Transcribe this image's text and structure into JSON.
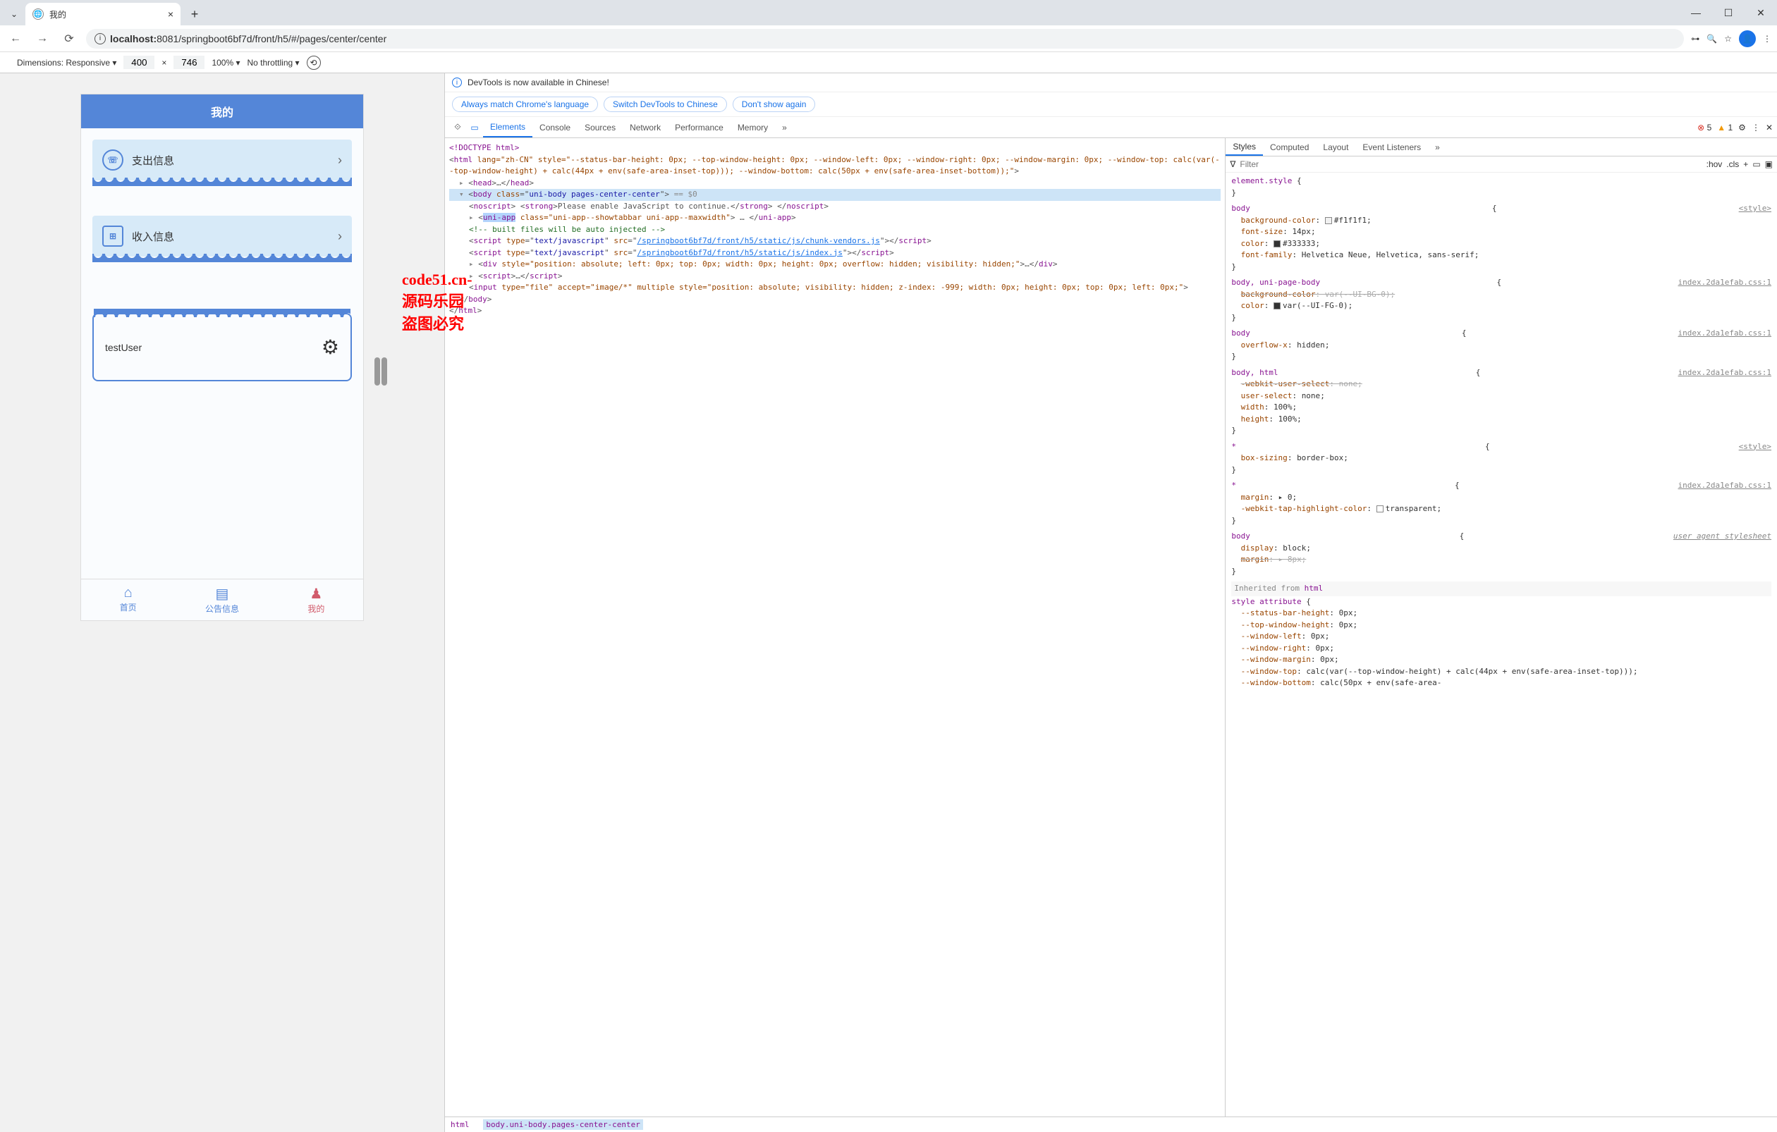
{
  "browser": {
    "tab_title": "我的",
    "url_prefix": "localhost:",
    "url_rest": "8081/springboot6bf7d/front/h5/#/pages/center/center",
    "min": "—",
    "max": "☐",
    "close": "✕"
  },
  "device_bar": {
    "label": "Dimensions: Responsive",
    "width": "400",
    "x": "×",
    "height": "746",
    "zoom": "100%",
    "throttling": "No throttling"
  },
  "mobile": {
    "header": "我的",
    "card1": "支出信息",
    "card2": "收入信息",
    "username": "testUser",
    "tabs": {
      "home": "首页",
      "notice": "公告信息",
      "mine": "我的"
    }
  },
  "devtools": {
    "banner": "DevTools is now available in Chinese!",
    "btn1": "Always match Chrome's language",
    "btn2": "Switch DevTools to Chinese",
    "btn3": "Don't show again",
    "tabs": {
      "elements": "Elements",
      "console": "Console",
      "sources": "Sources",
      "network": "Network",
      "performance": "Performance",
      "memory": "Memory"
    },
    "errors": "5",
    "warnings": "1",
    "styles_tabs": {
      "styles": "Styles",
      "computed": "Computed",
      "layout": "Layout",
      "listeners": "Event Listeners"
    },
    "filter_placeholder": "Filter",
    "hov": ":hov",
    "cls": ".cls",
    "breadcrumb_html": "html",
    "breadcrumb_body": "body.uni-body.pages-center-center"
  },
  "styles": {
    "css_file": "index.2da1efab.css:1",
    "style_label": "<style>",
    "user_agent": "user agent stylesheet",
    "inherited_label": "Inherited from ",
    "inherited_tag": "html",
    "style_attr_label": "style attribute"
  },
  "dom_text": {
    "doctype": "<!DOCTYPE html>",
    "html_attrs": " lang=\"zh-CN\" style=\"--status-bar-height: 0px; --top-window-height: 0px; --window-left: 0px; --window-right: 0px; --window-margin: 0px; --window-top: calc(var(--top-window-height) + calc(44px + env(safe-area-inset-top))); --window-bottom: calc(50px + env(safe-area-inset-bottom));\"",
    "noscript_content": "Please enable JavaScript to continue.",
    "uniapp_attrs": " class=\"uni-app--showtabbar uni-app--maxwidth\"",
    "comment": " built files will be auto injected ",
    "script_type": "text/javascript",
    "script1_src": "/springboot6bf7d/front/h5/static/js/chunk-vendors.js",
    "script2_src": "/springboot6bf7d/front/h5/static/js/index.js",
    "div_overlay": " style=\"position: absolute; left: 0px; top: 0px; width: 0px; height: 0px; overflow: hidden; visibility: hidden;\"",
    "input_file": " type=\"file\" accept=\"image/*\" multiple style=\"position: absolute; visibility: hidden; z-index: -999; width: 0px; height: 0px; top: 0px; left: 0px;\""
  },
  "watermark": "code51.cn-源码乐园盗图必究"
}
